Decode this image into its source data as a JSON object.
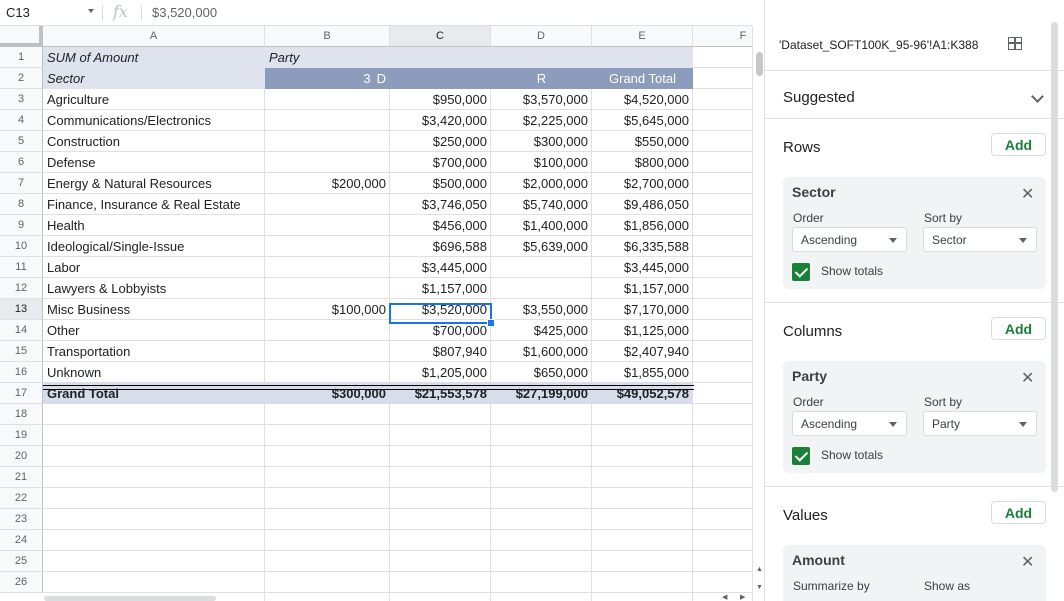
{
  "formula_bar": {
    "cell_ref": "C13",
    "fx_symbol": "fx",
    "value": "$3,520,000"
  },
  "columns": [
    "A",
    "B",
    "C",
    "D",
    "E",
    "F"
  ],
  "rows": [
    "1",
    "2",
    "3",
    "4",
    "5",
    "6",
    "7",
    "8",
    "9",
    "10",
    "11",
    "12",
    "13",
    "14",
    "15",
    "16",
    "17",
    "18",
    "19",
    "20",
    "21",
    "22",
    "23",
    "24",
    "25",
    "26"
  ],
  "pivot": {
    "r1": {
      "a": "SUM of Amount",
      "b": "Party"
    },
    "r2": {
      "a": "Sector",
      "b": "3",
      "b2": "D",
      "d": "R",
      "e": "Grand Total"
    },
    "data": [
      {
        "sector": "Agriculture",
        "three": "",
        "d": "$950,000",
        "r": "$3,570,000",
        "total": "$4,520,000"
      },
      {
        "sector": "Communications/Electronics",
        "three": "",
        "d": "$3,420,000",
        "r": "$2,225,000",
        "total": "$5,645,000"
      },
      {
        "sector": "Construction",
        "three": "",
        "d": "$250,000",
        "r": "$300,000",
        "total": "$550,000"
      },
      {
        "sector": "Defense",
        "three": "",
        "d": "$700,000",
        "r": "$100,000",
        "total": "$800,000"
      },
      {
        "sector": "Energy & Natural Resources",
        "three": "$200,000",
        "d": "$500,000",
        "r": "$2,000,000",
        "total": "$2,700,000"
      },
      {
        "sector": "Finance, Insurance & Real Estate",
        "three": "",
        "d": "$3,746,050",
        "r": "$5,740,000",
        "total": "$9,486,050"
      },
      {
        "sector": "Health",
        "three": "",
        "d": "$456,000",
        "r": "$1,400,000",
        "total": "$1,856,000"
      },
      {
        "sector": "Ideological/Single-Issue",
        "three": "",
        "d": "$696,588",
        "r": "$5,639,000",
        "total": "$6,335,588"
      },
      {
        "sector": "Labor",
        "three": "",
        "d": "$3,445,000",
        "r": "",
        "total": "$3,445,000"
      },
      {
        "sector": "Lawyers & Lobbyists",
        "three": "",
        "d": "$1,157,000",
        "r": "",
        "total": "$1,157,000"
      },
      {
        "sector": "Misc Business",
        "three": "$100,000",
        "d": "$3,520,000",
        "r": "$3,550,000",
        "total": "$7,170,000"
      },
      {
        "sector": "Other",
        "three": "",
        "d": "$700,000",
        "r": "$425,000",
        "total": "$1,125,000"
      },
      {
        "sector": "Transportation",
        "three": "",
        "d": "$807,940",
        "r": "$1,600,000",
        "total": "$2,407,940"
      },
      {
        "sector": "Unknown",
        "three": "",
        "d": "$1,205,000",
        "r": "$650,000",
        "total": "$1,855,000"
      }
    ],
    "grand_total": {
      "label": "Grand Total",
      "three": "$300,000",
      "d": "$21,553,578",
      "r": "$27,199,000",
      "total": "$49,052,578"
    }
  },
  "panel": {
    "range": "'Dataset_SOFT100K_95-96'!A1:K388",
    "suggested": "Suggested",
    "rows_title": "Rows",
    "columns_title": "Columns",
    "values_title": "Values",
    "add_label": "Add",
    "close_glyph": "✕",
    "rows_card": {
      "title": "Sector",
      "order_label": "Order",
      "order_value": "Ascending",
      "sort_label": "Sort by",
      "sort_value": "Sector",
      "show_totals": "Show totals"
    },
    "columns_card": {
      "title": "Party",
      "order_label": "Order",
      "order_value": "Ascending",
      "sort_label": "Sort by",
      "sort_value": "Party",
      "show_totals": "Show totals"
    },
    "values_card": {
      "title": "Amount",
      "summarize_label": "Summarize by",
      "show_as_label": "Show as"
    }
  },
  "colors": {
    "accent": "#1a73e8",
    "green": "#188038",
    "header_band": "#8c9cbd",
    "light_band": "#dfe3ed",
    "total_band": "#d7ddea"
  }
}
